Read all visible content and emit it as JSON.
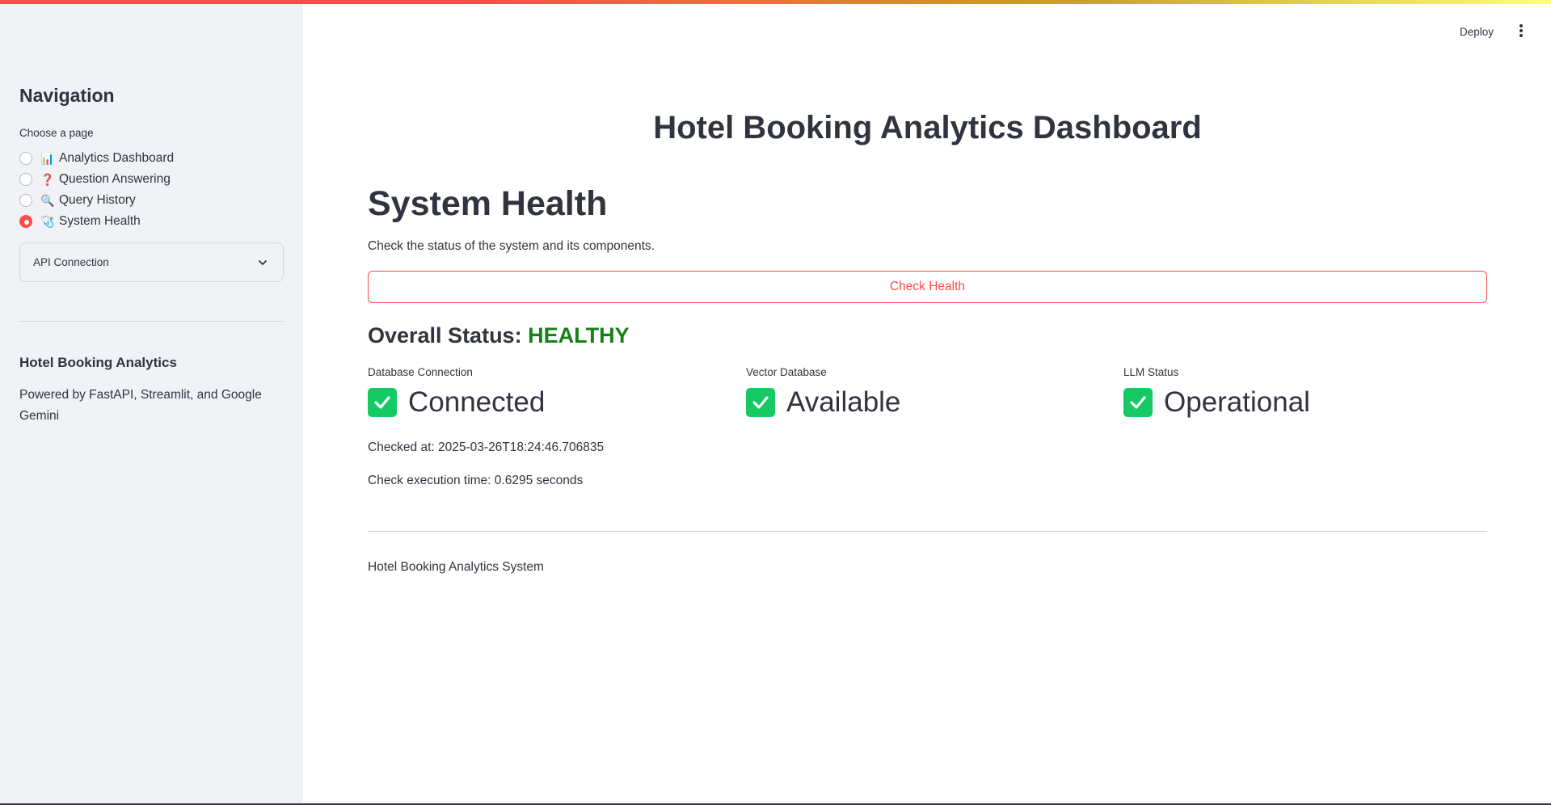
{
  "header": {
    "deploy_label": "Deploy",
    "menu_icon": "kebab-menu-icon"
  },
  "sidebar": {
    "title": "Navigation",
    "radio_label": "Choose a page",
    "pages": [
      {
        "emoji": "📊",
        "label": "Analytics Dashboard",
        "selected": false
      },
      {
        "emoji": "❓",
        "label": "Question Answering",
        "selected": false
      },
      {
        "emoji": "🔍",
        "label": "Query History",
        "selected": false
      },
      {
        "emoji": "🩺",
        "label": "System Health",
        "selected": true
      }
    ],
    "expander_label": "API Connection",
    "about_heading": "Hotel Booking Analytics",
    "about_text": "Powered by FastAPI, Streamlit, and Google Gemini"
  },
  "main": {
    "app_title": "Hotel Booking Analytics Dashboard",
    "section_title": "System Health",
    "section_description": "Check the status of the system and its components.",
    "check_button_label": "Check Health",
    "overall_status_label": "Overall Status:",
    "overall_status_value": "HEALTHY",
    "metrics": [
      {
        "label": "Database Connection",
        "value": "Connected"
      },
      {
        "label": "Vector Database",
        "value": "Available"
      },
      {
        "label": "LLM Status",
        "value": "Operational"
      }
    ],
    "checked_at": "Checked at: 2025-03-26T18:24:46.706835",
    "execution_time": "Check execution time: 0.6295 seconds",
    "footer": "Hotel Booking Analytics System"
  },
  "colors": {
    "accent": "#ff4b4b",
    "healthy": "#178117",
    "check_icon_bg": "#17c964",
    "sidebar_bg": "#f0f2f6",
    "text": "#31333f"
  }
}
